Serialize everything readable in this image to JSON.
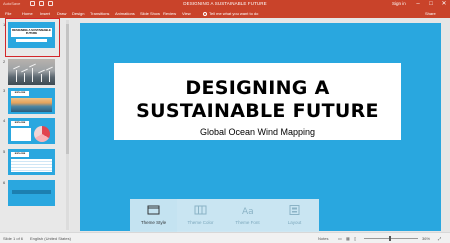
{
  "window": {
    "autosave": "AutoSave",
    "title": "DESIGNING A SUSTAINABLE FUTURE",
    "sign_in": "Sign in",
    "minimize": "–",
    "maximize": "□",
    "close": "✕"
  },
  "ribbon": {
    "tabs": [
      "File",
      "Home",
      "Insert",
      "Draw",
      "Design",
      "Transitions",
      "Animations",
      "Slide Show",
      "Review",
      "View"
    ],
    "tell_me": "Tell me what you want to do",
    "share": "Share"
  },
  "slides_pane": {
    "numbers": [
      "1",
      "2",
      "3",
      "4",
      "5",
      "6"
    ],
    "thumb1": {
      "title": "DESIGNING A SUSTAINABLE FUTURE"
    },
    "thumb3": {
      "heading": "EXPLORE"
    },
    "thumb4": {
      "heading": "EXPLORE"
    },
    "thumb5": {
      "heading": "EXPLORE"
    }
  },
  "slide": {
    "title": "DESIGNING A SUSTAINABLE FUTURE",
    "subtitle": "Global Ocean Wind Mapping",
    "background": "#29a7df"
  },
  "design_ideas": {
    "items": [
      {
        "label": "Theme Style",
        "icon": "theme-style-icon"
      },
      {
        "label": "Theme Color",
        "icon": "theme-color-icon"
      },
      {
        "label": "Theme Font",
        "icon": "theme-font-icon"
      },
      {
        "label": "Layout",
        "icon": "layout-icon"
      }
    ],
    "selected_index": 0
  },
  "status_bar": {
    "slide_count": "Slide 1 of 6",
    "language": "English (United States)",
    "notes": "Notes",
    "zoom": "36%"
  },
  "colors": {
    "ribbon": "#c9432a",
    "slide_bg": "#29a7df",
    "selection": "#d3262a"
  }
}
